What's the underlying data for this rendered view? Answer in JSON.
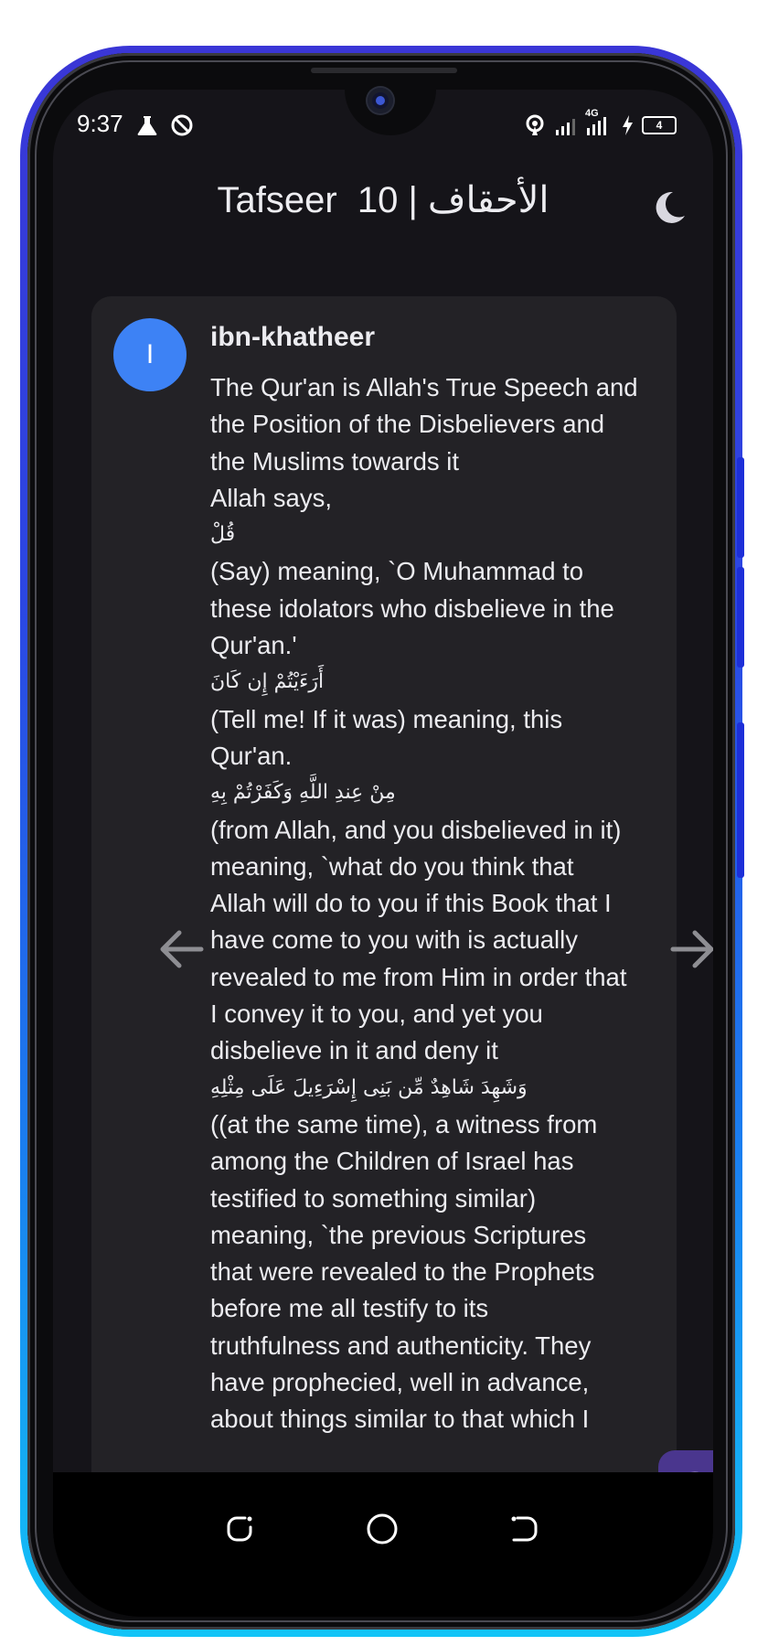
{
  "status_bar": {
    "time": "9:37",
    "battery": "4",
    "network": "4G"
  },
  "app_bar": {
    "title": "Tafseer  10 | الأحقاف",
    "theme_toggle_icon": "moon-icon"
  },
  "tafseer": {
    "avatar_letter": "I",
    "author": "ibn-khatheer",
    "lines": [
      {
        "text": "The Qur'an is Allah's True Speech and",
        "ar": false
      },
      {
        "text": "the Position of the Disbelievers and",
        "ar": false
      },
      {
        "text": "the Muslims towards it",
        "ar": false
      },
      {
        "text": "Allah says,",
        "ar": false
      },
      {
        "text": "قُلْ",
        "ar": true
      },
      {
        "text": "(Say) meaning, `O Muhammad to",
        "ar": false
      },
      {
        "text": "these idolators who disbelieve in the",
        "ar": false
      },
      {
        "text": "Qur'an.'",
        "ar": false
      },
      {
        "text": "أَرَءَيْتُمْ إِن كَانَ",
        "ar": true
      },
      {
        "text": "(Tell me! If it was) meaning, this",
        "ar": false
      },
      {
        "text": "Qur'an.",
        "ar": false
      },
      {
        "text": "مِنْ عِندِ اللَّهِ وَكَفَرْتُمْ بِهِ",
        "ar": true
      },
      {
        "text": "(from Allah, and you disbelieved in it)",
        "ar": false
      },
      {
        "text": "meaning, `what do you think that",
        "ar": false
      },
      {
        "text": "Allah will do to you if this Book that I",
        "ar": false
      },
      {
        "text": "have come to you with is actually",
        "ar": false
      },
      {
        "text": "revealed to me from Him in order that",
        "ar": false
      },
      {
        "text": "I convey it to you, and yet you",
        "ar": false
      },
      {
        "text": "disbelieve in it and deny it",
        "ar": false
      },
      {
        "text": "وَشَهِدَ شَاهِدٌ مِّن بَنِى إِسْرَءِيلَ عَلَى مِثْلِهِ",
        "ar": true
      },
      {
        "text": "((at the same time), a witness from",
        "ar": false
      },
      {
        "text": "among the Children of Israel has",
        "ar": false
      },
      {
        "text": "testified to something similar)",
        "ar": false
      },
      {
        "text": "meaning, `the previous Scriptures",
        "ar": false
      },
      {
        "text": "that were revealed to the Prophets",
        "ar": false
      },
      {
        "text": "before me all testify to its",
        "ar": false
      },
      {
        "text": "truthfulness and authenticity. They",
        "ar": false
      },
      {
        "text": "have prophecied, well in advance,",
        "ar": false
      },
      {
        "text": "about things similar to that which I",
        "ar": false
      }
    ]
  },
  "nav": {
    "prev_icon": "arrow-left-icon",
    "next_icon": "arrow-right-icon",
    "fab_icon": "swipe-gesture-icon"
  },
  "colors": {
    "background": "#151419",
    "card": "#232226",
    "avatar": "#3d82f5",
    "fab": "#4a368e",
    "text": "#ececf0"
  }
}
